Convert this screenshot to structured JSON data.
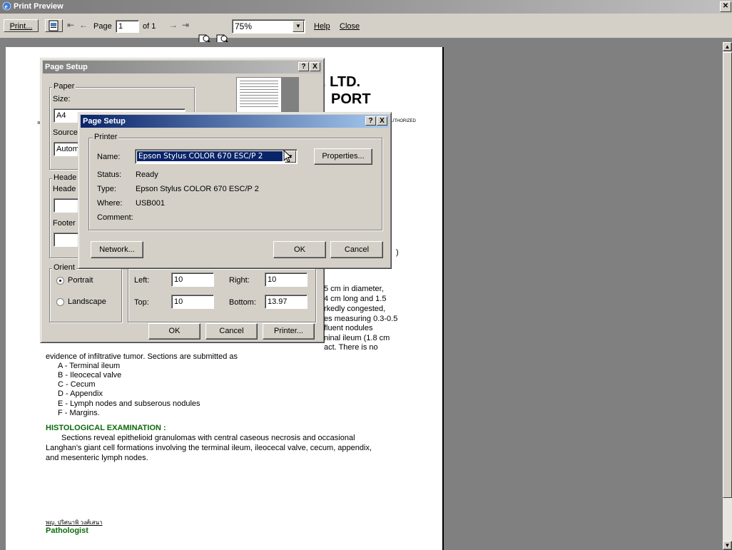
{
  "window": {
    "title": "Print Preview",
    "close_glyph": "✕"
  },
  "toolbar": {
    "print_label": "Print...",
    "page_label": "Page",
    "page_value": "1",
    "of_label": "of 1",
    "zoom_value": "75%",
    "help_label": "Help",
    "close_label": "Close"
  },
  "report": {
    "company_partial": ", LTD.",
    "report_partial": "PORT",
    "left_edge_char": "ล",
    "authorized_partial": "UTHORIZED",
    "right_frag_1": "5 cm in diameter,",
    "right_frag_2": "4 cm long and 1.5",
    "right_frag_3": "rkedly congested,",
    "right_frag_4": "es measuring 0.3-0.5",
    "right_frag_5": "fluent nodules",
    "right_frag_6": "ninal ileum (1.8 cm",
    "right_frag_7": "act. There is no",
    "paren_frag": ")",
    "line_evidence": "evidence of infiltrative tumor. Sections are submitted as",
    "sections": [
      "A - Terminal ileum",
      "B - Ileocecal valve",
      "C - Cecum",
      "D - Appendix",
      "E - Lymph nodes and subserous nodules",
      "F - Margins."
    ],
    "histo_heading": "HISTOLOGICAL EXAMINATION :",
    "histo_line1": "Sections reveal epithelioid granulomas with central caseous necrosis and occasional",
    "histo_line2": "Langhan's giant cell formations involving the terminal ileum, ileocecal valve, cecum, appendix,",
    "histo_line3": "and mesenteric lymph nodes.",
    "signature_name": "พญ. ปริศนาพิ วงศ์เสนา",
    "pathologist_label": "Pathologist"
  },
  "page_setup": {
    "title": "Page Setup",
    "help_glyph": "?",
    "close_glyph": "X",
    "paper_group": "Paper",
    "size_label": "Size:",
    "size_value": "A4",
    "source_label": "Source",
    "source_value": "Autom",
    "headers_group": "Heade",
    "header_label": "Heade",
    "footer_label": "Footer",
    "orientation_group": "Orient",
    "portrait_label": "Portrait",
    "landscape_label": "Landscape",
    "left_label": "Left:",
    "left_value": "10",
    "right_label": "Right:",
    "right_value": "10",
    "top_label": "Top:",
    "top_value": "10",
    "bottom_label": "Bottom:",
    "bottom_value": "13.97",
    "ok_label": "OK",
    "cancel_label": "Cancel",
    "printer_label": "Printer..."
  },
  "printer_dialog": {
    "title": "Page Setup",
    "help_glyph": "?",
    "close_glyph": "X",
    "group_label": "Printer",
    "name_label": "Name:",
    "name_value": "Epson Stylus COLOR 670 ESC/P 2",
    "properties_label": "Properties...",
    "status_label": "Status:",
    "status_value": "Ready",
    "type_label": "Type:",
    "type_value": "Epson Stylus COLOR 670 ESC/P 2",
    "where_label": "Where:",
    "where_value": "USB001",
    "comment_label": "Comment:",
    "network_label": "Network...",
    "ok_label": "OK",
    "cancel_label": "Cancel"
  }
}
